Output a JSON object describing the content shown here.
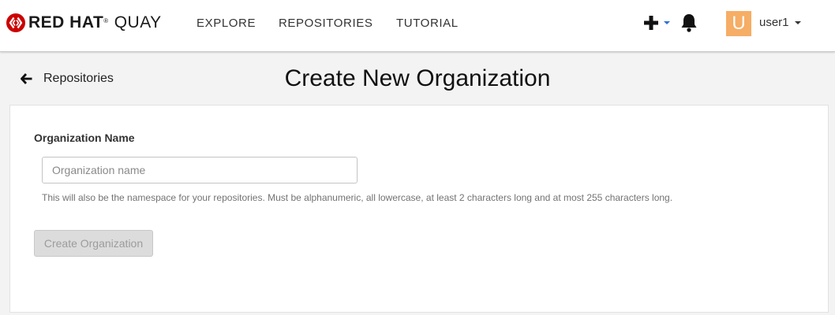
{
  "brand": {
    "red_hat": "RED HAT",
    "registered": "®",
    "product": "QUAY",
    "logo_color": "#cc0000"
  },
  "nav": {
    "links": [
      "EXPLORE",
      "REPOSITORIES",
      "TUTORIAL"
    ]
  },
  "header_right": {
    "create_icon": "plus-icon",
    "notification_icon": "bell-icon",
    "avatar_letter": "U",
    "avatar_color": "#f6ad65",
    "username": "user1"
  },
  "breadcrumb": {
    "back_label": "Repositories"
  },
  "page": {
    "title": "Create New Organization"
  },
  "form": {
    "org_name_label": "Organization Name",
    "org_name_placeholder": "Organization name",
    "org_name_value": "",
    "help": "This will also be the namespace for your repositories. Must be alphanumeric, all lowercase, at least 2 characters long and at most 255 characters long.",
    "submit_label": "Create Organization",
    "submit_disabled": true
  }
}
